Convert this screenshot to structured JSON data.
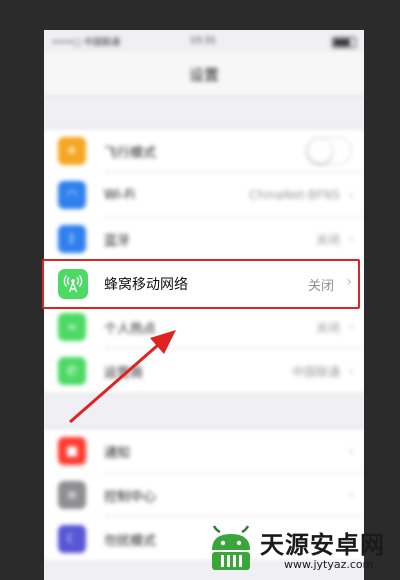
{
  "status_bar": {
    "signal": "••••○ 中国联通 ",
    "time": "15:31"
  },
  "nav": {
    "title": "设置"
  },
  "group1": [
    {
      "label": "飞行模式",
      "value": "",
      "color": "#f5a623",
      "icon": "airplane-icon",
      "glyph": "✈",
      "toggle": true
    },
    {
      "label": "Wi-Fi",
      "value": "ChinaNet-BFNS",
      "color": "#2f80ed",
      "icon": "wifi-icon",
      "glyph": "◠",
      "toggle": false
    },
    {
      "label": "蓝牙",
      "value": "关闭",
      "color": "#2f80ed",
      "icon": "bluetooth-icon",
      "glyph": "ᛒ",
      "toggle": false
    }
  ],
  "highlight": {
    "label": "蜂窝移动网络",
    "value": "关闭",
    "chevron": "›",
    "color": "#4cd964",
    "icon": "cellular-antenna-icon"
  },
  "group1_after": [
    {
      "label": "个人热点",
      "value": "关闭",
      "color": "#4cd964",
      "icon": "hotspot-icon",
      "glyph": "∞"
    },
    {
      "label": "运营商",
      "value": "中国联通",
      "color": "#4cd964",
      "icon": "phone-icon",
      "glyph": "✆"
    }
  ],
  "group2": [
    {
      "label": "通知",
      "value": "",
      "color": "#ff3b30",
      "icon": "notification-icon",
      "glyph": "■"
    },
    {
      "label": "控制中心",
      "value": "",
      "color": "#8e8e93",
      "icon": "control-center-icon",
      "glyph": "≡"
    },
    {
      "label": "勿扰模式",
      "value": "",
      "color": "#5856d6",
      "icon": "moon-icon",
      "glyph": "☾"
    }
  ],
  "watermark": {
    "brand": "天源安卓网",
    "url": "www.jytyaz.com"
  },
  "colors": {
    "annotation_red": "#e02222",
    "ios_green": "#4cd964"
  }
}
